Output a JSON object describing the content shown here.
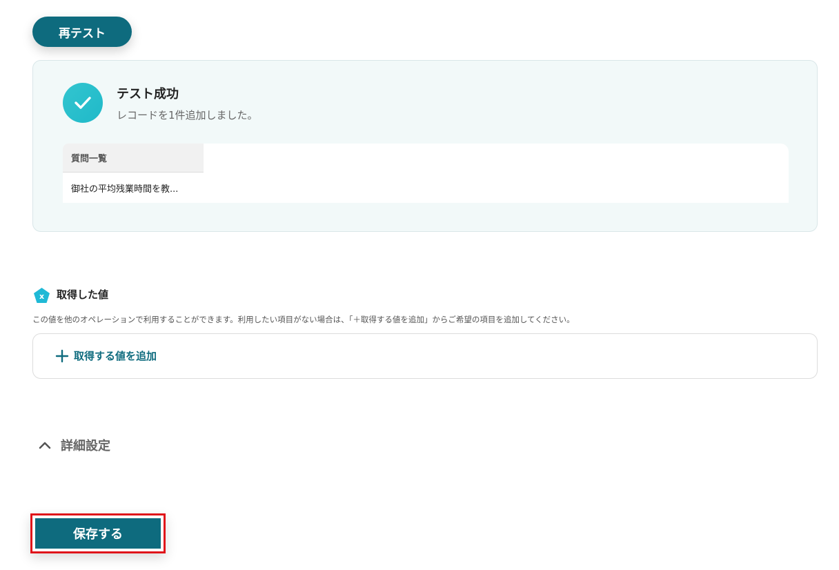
{
  "retest_button": {
    "label": "再テスト"
  },
  "test_result": {
    "title": "テスト成功",
    "message": "レコードを1件追加しました。",
    "table": {
      "header": "質問一覧",
      "cell": "御社の平均残業時間を教..."
    }
  },
  "acquired_values": {
    "title": "取得した値",
    "description": "この値を他のオペレーションで利用することができます。利用したい項目がない場合は、「＋取得する値を追加」からご希望の項目を追加してください。",
    "add_button_label": "取得する値を追加",
    "icon_letter": "x"
  },
  "details": {
    "label": "詳細設定"
  },
  "save_button": {
    "label": "保存する"
  },
  "colors": {
    "primary": "#0e6b7e",
    "success": "#2ec1cd",
    "panel_bg": "#f2f9f9",
    "highlight_border": "#e0131a"
  }
}
